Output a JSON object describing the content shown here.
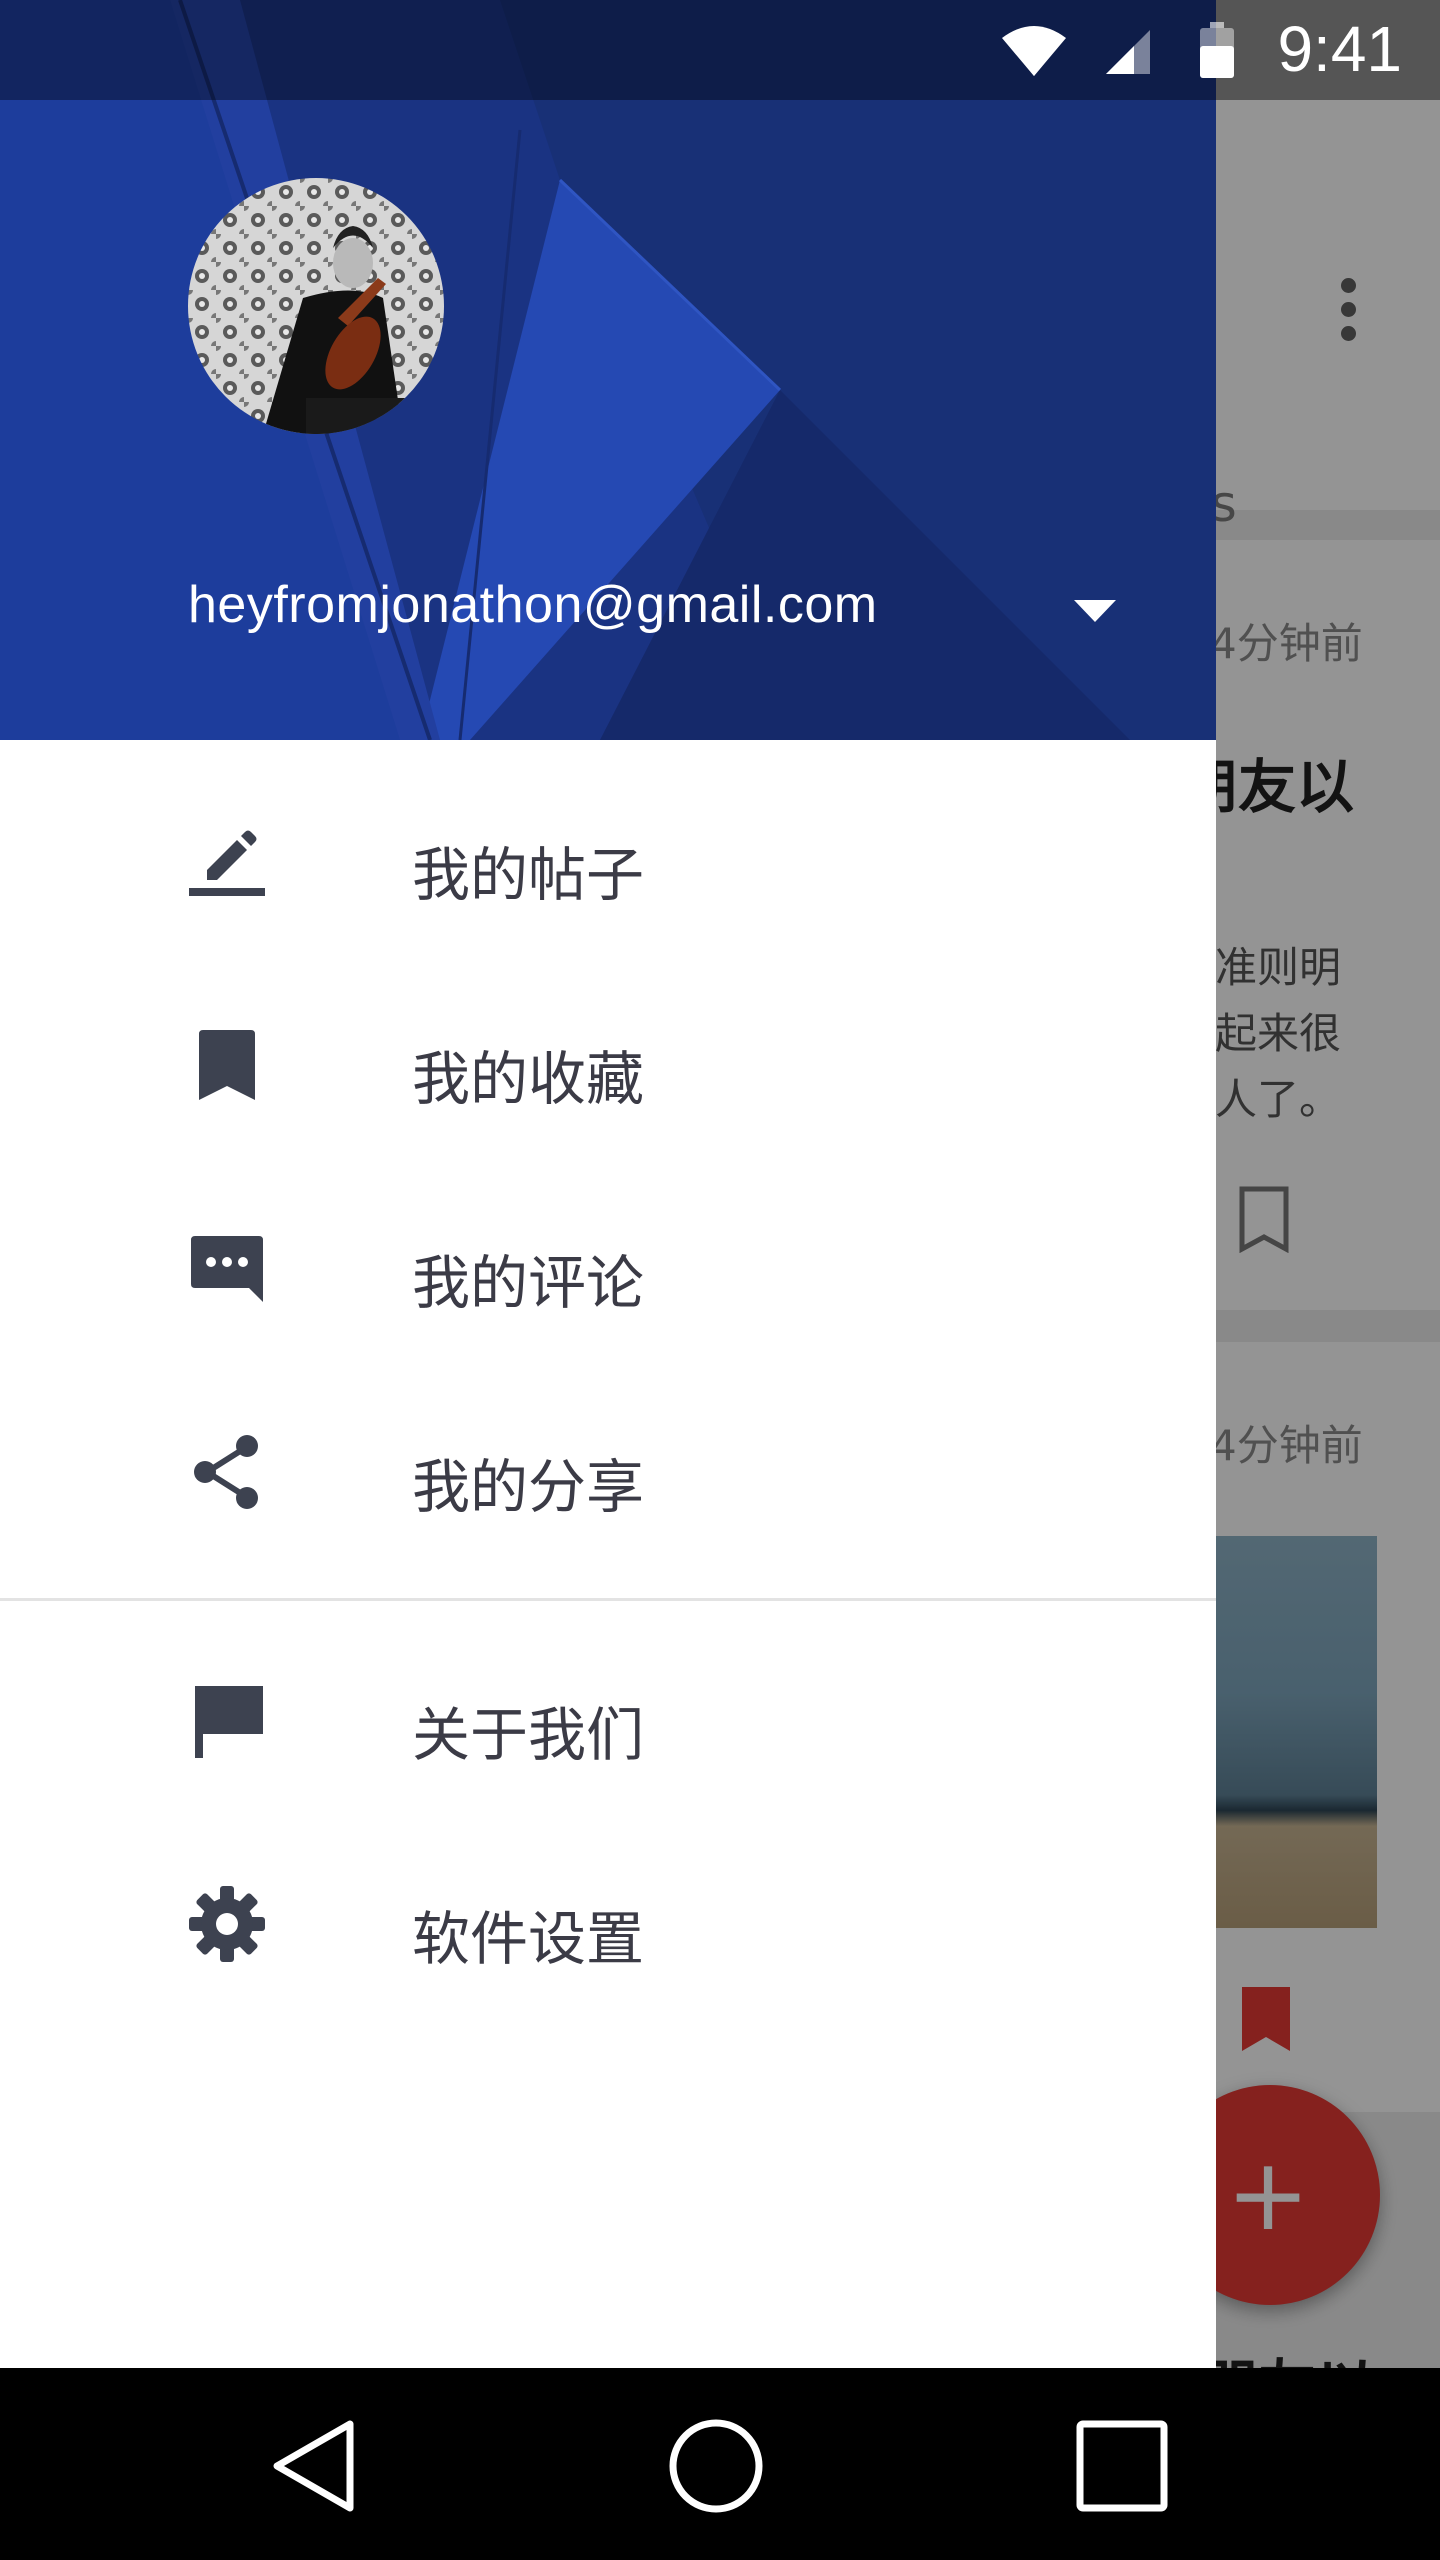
{
  "status_bar": {
    "time": "9:41"
  },
  "drawer": {
    "header": {
      "account_email": "heyfromjonathon@gmail.com"
    },
    "menu_items": [
      {
        "label": "我的帖子",
        "icon": "edit-icon"
      },
      {
        "label": "我的收藏",
        "icon": "bookmark-icon"
      },
      {
        "label": "我的评论",
        "icon": "comment-icon"
      },
      {
        "label": "我的分享",
        "icon": "share-icon"
      }
    ],
    "secondary_items": [
      {
        "label": "关于我们",
        "icon": "flag-icon"
      },
      {
        "label": "软件设置",
        "icon": "settings-icon"
      }
    ]
  },
  "background_screen": {
    "tab_fragment": "es",
    "card1": {
      "time": "4分钟前",
      "title_fragment": "朋友以",
      "body_lines": [
        "准则明",
        "起来很",
        "人了。"
      ]
    },
    "card2": {
      "time": "4分钟前"
    },
    "card3_title_fragment": "朋友以"
  },
  "colors": {
    "header_blue": "#1e3c9a",
    "fab_red": "#e53935",
    "menu_text": "#3b3b46",
    "icon_grey": "#3d4250"
  },
  "nav_bar": {
    "buttons": [
      "back",
      "home",
      "recents"
    ]
  }
}
